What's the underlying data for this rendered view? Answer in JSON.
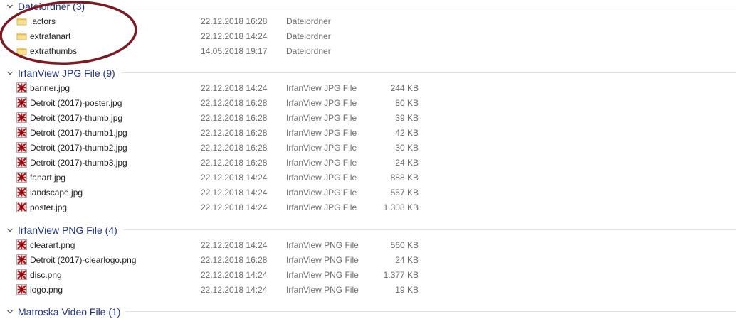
{
  "colors": {
    "group_header_text": "#1e3287",
    "folder_yellow": "#f8d775",
    "irfan_red": "#c0171c",
    "annotation_circle": "#7a1a22"
  },
  "groups": [
    {
      "title": "Dateiordner (3)",
      "kind": "folder",
      "items": [
        {
          "name": ".actors",
          "date": "22.12.2018 16:28",
          "type": "Dateiordner",
          "size": "",
          "icon": "folder-icon"
        },
        {
          "name": "extrafanart",
          "date": "22.12.2018 14:24",
          "type": "Dateiordner",
          "size": "",
          "icon": "folder-icon"
        },
        {
          "name": "extrathumbs",
          "date": "14.05.2018 19:17",
          "type": "Dateiordner",
          "size": "",
          "icon": "folder-icon"
        }
      ]
    },
    {
      "title": "IrfanView JPG File (9)",
      "kind": "image",
      "items": [
        {
          "name": "banner.jpg",
          "date": "22.12.2018 14:24",
          "type": "IrfanView JPG File",
          "size": "244 KB",
          "icon": "irfanview-icon"
        },
        {
          "name": "Detroit (2017)-poster.jpg",
          "date": "22.12.2018 16:28",
          "type": "IrfanView JPG File",
          "size": "80 KB",
          "icon": "irfanview-icon"
        },
        {
          "name": "Detroit (2017)-thumb.jpg",
          "date": "22.12.2018 16:28",
          "type": "IrfanView JPG File",
          "size": "39 KB",
          "icon": "irfanview-icon"
        },
        {
          "name": "Detroit (2017)-thumb1.jpg",
          "date": "22.12.2018 16:28",
          "type": "IrfanView JPG File",
          "size": "42 KB",
          "icon": "irfanview-icon"
        },
        {
          "name": "Detroit (2017)-thumb2.jpg",
          "date": "22.12.2018 16:28",
          "type": "IrfanView JPG File",
          "size": "30 KB",
          "icon": "irfanview-icon"
        },
        {
          "name": "Detroit (2017)-thumb3.jpg",
          "date": "22.12.2018 16:28",
          "type": "IrfanView JPG File",
          "size": "24 KB",
          "icon": "irfanview-icon"
        },
        {
          "name": "fanart.jpg",
          "date": "22.12.2018 14:24",
          "type": "IrfanView JPG File",
          "size": "888 KB",
          "icon": "irfanview-icon"
        },
        {
          "name": "landscape.jpg",
          "date": "22.12.2018 14:24",
          "type": "IrfanView JPG File",
          "size": "557 KB",
          "icon": "irfanview-icon"
        },
        {
          "name": "poster.jpg",
          "date": "22.12.2018 14:24",
          "type": "IrfanView JPG File",
          "size": "1.308 KB",
          "icon": "irfanview-icon"
        }
      ]
    },
    {
      "title": "IrfanView PNG File (4)",
      "kind": "image",
      "items": [
        {
          "name": "clearart.png",
          "date": "22.12.2018 14:24",
          "type": "IrfanView PNG File",
          "size": "560 KB",
          "icon": "irfanview-icon"
        },
        {
          "name": "Detroit (2017)-clearlogo.png",
          "date": "22.12.2018 16:28",
          "type": "IrfanView PNG File",
          "size": "24 KB",
          "icon": "irfanview-icon"
        },
        {
          "name": "disc.png",
          "date": "22.12.2018 14:24",
          "type": "IrfanView PNG File",
          "size": "1.377 KB",
          "icon": "irfanview-icon"
        },
        {
          "name": "logo.png",
          "date": "22.12.2018 14:24",
          "type": "IrfanView PNG File",
          "size": "19 KB",
          "icon": "irfanview-icon"
        }
      ]
    },
    {
      "title": "Matroska Video File (1)",
      "kind": "video",
      "items": []
    }
  ]
}
